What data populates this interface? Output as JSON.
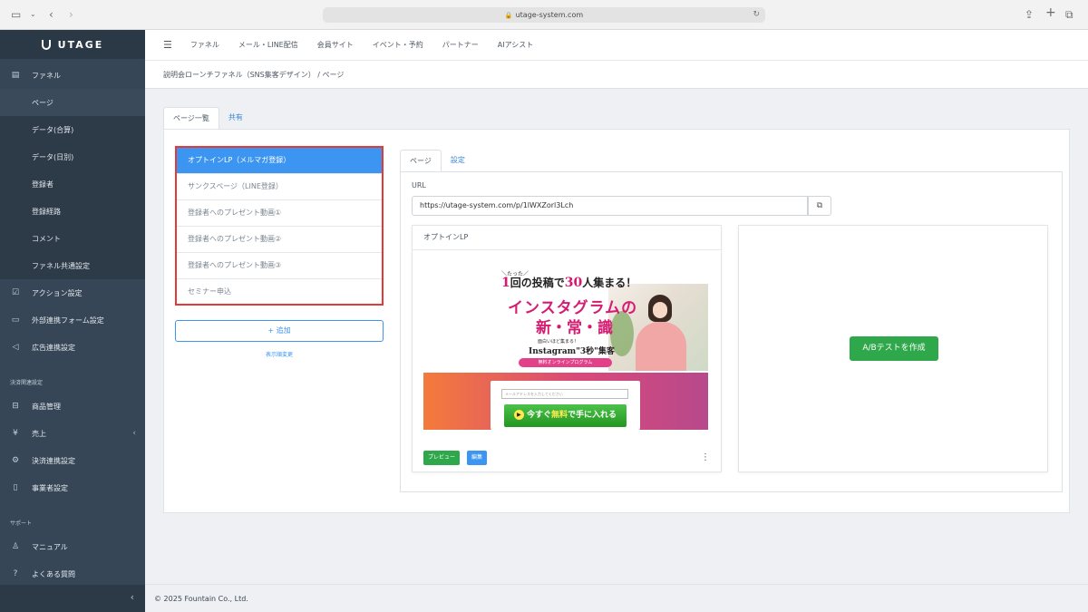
{
  "browser": {
    "url": "utage-system.com"
  },
  "sidebar": {
    "logo": "UTAGE",
    "items": [
      {
        "label": "ファネル",
        "icon": "funnel-icon"
      },
      {
        "label": "ページ"
      },
      {
        "label": "データ(合算)"
      },
      {
        "label": "データ(日別)"
      },
      {
        "label": "登録者"
      },
      {
        "label": "登録経路"
      },
      {
        "label": "コメント"
      },
      {
        "label": "ファネル共通設定"
      },
      {
        "label": "アクション設定",
        "icon": "action-icon"
      },
      {
        "label": "外部連携フォーム設定",
        "icon": "form-icon"
      },
      {
        "label": "広告連携設定",
        "icon": "megaphone-icon"
      },
      {
        "label": "商品管理",
        "icon": "basket-icon"
      },
      {
        "label": "売上",
        "icon": "yen-icon"
      },
      {
        "label": "決済連携設定",
        "icon": "gear-icon"
      },
      {
        "label": "事業者設定",
        "icon": "building-icon"
      },
      {
        "label": "マニュアル",
        "icon": "manual-icon"
      },
      {
        "label": "よくある質問",
        "icon": "question-icon"
      }
    ],
    "sections": {
      "payment": "決済関連設定",
      "support": "サポート"
    }
  },
  "topnav": {
    "items": [
      "ファネル",
      "メール・LINE配信",
      "会員サイト",
      "イベント・予約",
      "パートナー",
      "AIアシスト"
    ]
  },
  "breadcrumb": "説明会ローンチファネル（SNS集客デザイン） / ページ",
  "tabs": {
    "pages": "ページ一覧",
    "share": "共有"
  },
  "page_list": [
    "オプトインLP（メルマガ登録）",
    "サンクスページ（LINE登録）",
    "登録者へのプレゼント動画①",
    "登録者へのプレゼント動画②",
    "登録者へのプレゼント動画③",
    "セミナー申込"
  ],
  "add_button": "+ 追加",
  "order_link": "表示順変更",
  "right_tabs": {
    "page": "ページ",
    "settings": "設定"
  },
  "url_label": "URL",
  "url_value": "https://utage-system.com/p/1lWXZorl3Lch",
  "card": {
    "title": "オプトインLP",
    "preview_button": "プレビュー",
    "edit_button": "編集"
  },
  "thumbnail": {
    "sub": "＼たった／",
    "lead_num": "1",
    "lead_a": "回の投稿で",
    "lead_num2": "30",
    "lead_b": "人集まる！",
    "headline1": "インスタグラムの",
    "headline2": "新・常・識",
    "sub2": "面白いほど集まる！",
    "sub3": "Instagram\"3秒\"集客",
    "pill": "無料オンラインプログラム",
    "input_placeholder": "メールアドレスを入力してください",
    "cta_a": "今すぐ",
    "cta_b": "無料",
    "cta_c": "で手に入れる"
  },
  "ab_button": "A/Bテストを作成",
  "footer": "© 2025 Fountain Co., Ltd."
}
